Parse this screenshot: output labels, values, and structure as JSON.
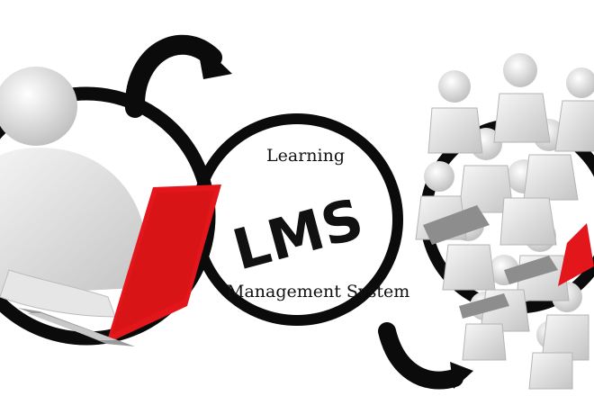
{
  "diagram": {
    "center_logo": "LMS",
    "label_top": "Learning",
    "label_bottom": "Management System"
  },
  "colors": {
    "ring": "#0b0b0b",
    "laptop": "#e3171b",
    "figure": "#f2f2f2",
    "figure_shade": "#c9c9c9",
    "background": "#ffffff"
  },
  "icons": [
    "single-learner-figure",
    "laptop-icon",
    "learner-group-figures",
    "curved-arrow-icon"
  ]
}
